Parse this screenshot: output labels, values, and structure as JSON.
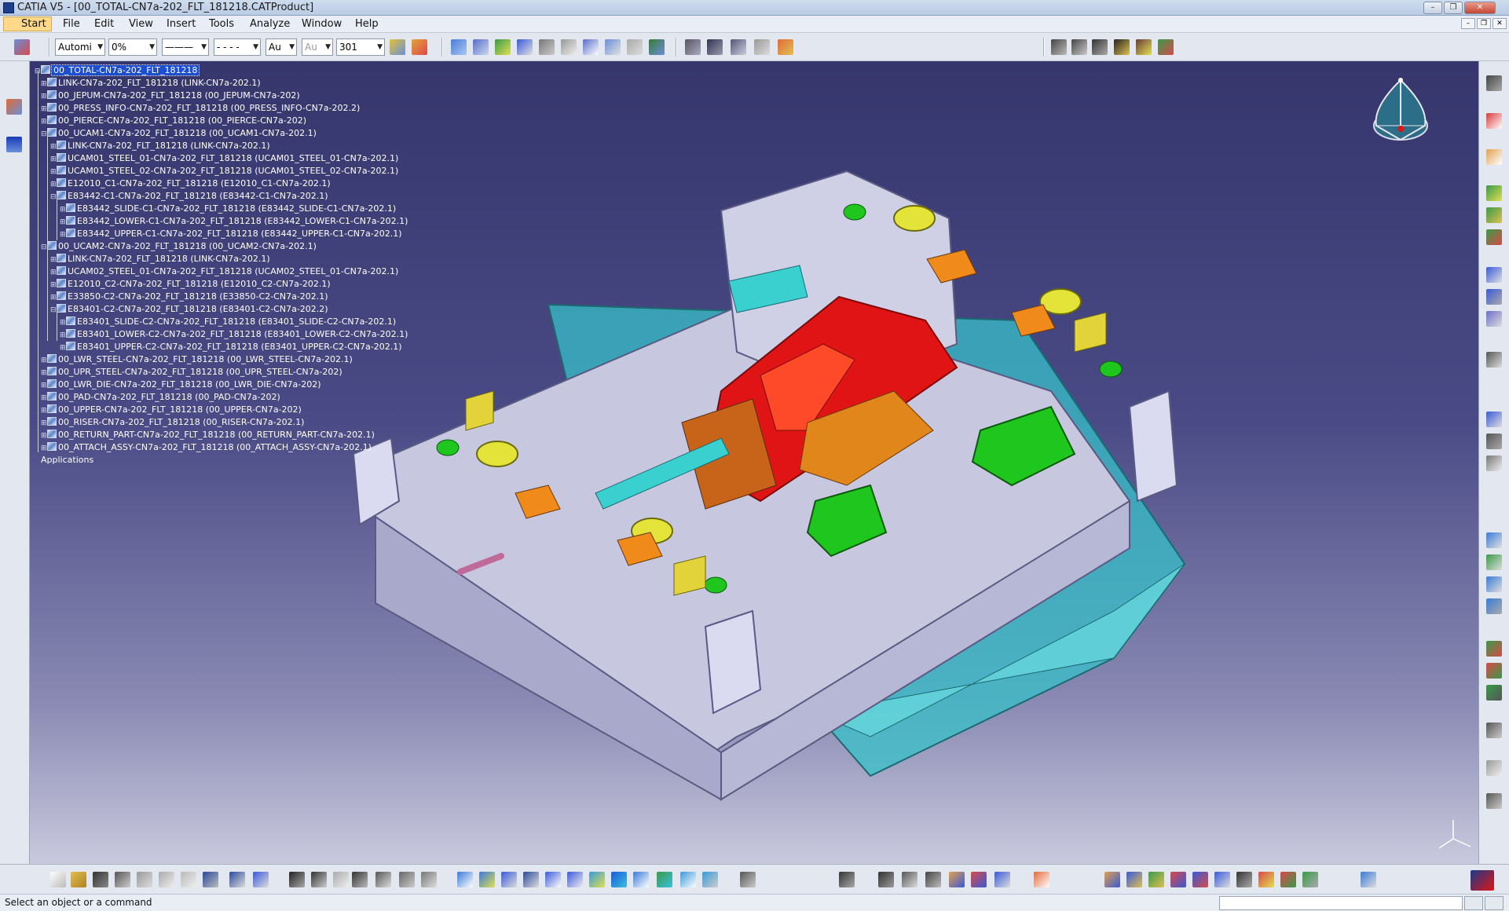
{
  "window": {
    "title": "CATIA V5 - [00_TOTAL-CN7a-202_FLT_181218.CATProduct]"
  },
  "menu": {
    "items": [
      "Start",
      "File",
      "Edit",
      "View",
      "Insert",
      "Tools",
      "Analyze",
      "Window",
      "Help"
    ]
  },
  "toolbar": {
    "combo_color": "Automi",
    "combo_transparency": "0%",
    "combo_linetype": "———",
    "combo_linestyle": "- - - -",
    "combo_weight": "Au",
    "combo_layer_disabled": "Au",
    "combo_layer": "301"
  },
  "tree": {
    "nodes": [
      {
        "label": "00_TOTAL-CN7a-202_FLT_181218",
        "selected": true
      },
      {
        "label": "LINK-CN7a-202_FLT_181218 (LINK-CN7a-202.1)"
      },
      {
        "label": "00_JEPUM-CN7a-202_FLT_181218 (00_JEPUM-CN7a-202)"
      },
      {
        "label": "00_PRESS_INFO-CN7a-202_FLT_181218 (00_PRESS_INFO-CN7a-202.2)"
      },
      {
        "label": "00_PIERCE-CN7a-202_FLT_181218 (00_PIERCE-CN7a-202)"
      },
      {
        "label": "00_UCAM1-CN7a-202_FLT_181218 (00_UCAM1-CN7a-202.1)"
      },
      {
        "label": "LINK-CN7a-202_FLT_181218 (LINK-CN7a-202.1)"
      },
      {
        "label": "UCAM01_STEEL_01-CN7a-202_FLT_181218 (UCAM01_STEEL_01-CN7a-202.1)"
      },
      {
        "label": "UCAM01_STEEL_02-CN7a-202_FLT_181218 (UCAM01_STEEL_02-CN7a-202.1)"
      },
      {
        "label": "E12010_C1-CN7a-202_FLT_181218 (E12010_C1-CN7a-202.1)"
      },
      {
        "label": "E83442-C1-CN7a-202_FLT_181218 (E83442-C1-CN7a-202.1)"
      },
      {
        "label": "E83442_SLIDE-C1-CN7a-202_FLT_181218 (E83442_SLIDE-C1-CN7a-202.1)"
      },
      {
        "label": "E83442_LOWER-C1-CN7a-202_FLT_181218 (E83442_LOWER-C1-CN7a-202.1)"
      },
      {
        "label": "E83442_UPPER-C1-CN7a-202_FLT_181218 (E83442_UPPER-C1-CN7a-202.1)"
      },
      {
        "label": "00_UCAM2-CN7a-202_FLT_181218 (00_UCAM2-CN7a-202.1)"
      },
      {
        "label": "LINK-CN7a-202_FLT_181218 (LINK-CN7a-202.1)"
      },
      {
        "label": "UCAM02_STEEL_01-CN7a-202_FLT_181218 (UCAM02_STEEL_01-CN7a-202.1)"
      },
      {
        "label": "E12010_C2-CN7a-202_FLT_181218 (E12010_C2-CN7a-202.1)"
      },
      {
        "label": "E33850-C2-CN7a-202_FLT_181218 (E33850-C2-CN7a-202.1)"
      },
      {
        "label": "E83401-C2-CN7a-202_FLT_181218 (E83401-C2-CN7a-202.2)"
      },
      {
        "label": "E83401_SLIDE-C2-CN7a-202_FLT_181218 (E83401_SLIDE-C2-CN7a-202.1)"
      },
      {
        "label": "E83401_LOWER-C2-CN7a-202_FLT_181218 (E83401_LOWER-C2-CN7a-202.1)"
      },
      {
        "label": "E83401_UPPER-C2-CN7a-202_FLT_181218 (E83401_UPPER-C2-CN7a-202.1)"
      },
      {
        "label": "00_LWR_STEEL-CN7a-202_FLT_181218 (00_LWR_STEEL-CN7a-202.1)"
      },
      {
        "label": "00_UPR_STEEL-CN7a-202_FLT_181218 (00_UPR_STEEL-CN7a-202)"
      },
      {
        "label": "00_LWR_DIE-CN7a-202_FLT_181218 (00_LWR_DIE-CN7a-202)"
      },
      {
        "label": "00_PAD-CN7a-202_FLT_181218 (00_PAD-CN7a-202)"
      },
      {
        "label": "00_UPPER-CN7a-202_FLT_181218 (00_UPPER-CN7a-202)"
      },
      {
        "label": "00_RISER-CN7a-202_FLT_181218 (00_RISER-CN7a-202.1)"
      },
      {
        "label": "00_RETURN_PART-CN7a-202_FLT_181218 (00_RETURN_PART-CN7a-202.1)"
      },
      {
        "label": "00_ATTACH_ASSY-CN7a-202_FLT_181218 (00_ATTACH_ASSY-CN7a-202.1)"
      },
      {
        "label": "Applications"
      }
    ]
  },
  "status": {
    "message": "Select an object or a command"
  },
  "colors": {
    "viewport_top": "#36366d",
    "viewport_bottom": "#c9c9de",
    "selection": "#1b4fd0",
    "part_red": "#e01414",
    "part_cyan": "#3fc4c4",
    "part_lavender": "#c9c9e4",
    "part_green": "#1ec61e",
    "part_yellow": "#e3e33a",
    "part_orange": "#f08a1a"
  },
  "icons": [
    "compass-icon",
    "axis-triad-icon",
    "catia-logo-icon"
  ]
}
